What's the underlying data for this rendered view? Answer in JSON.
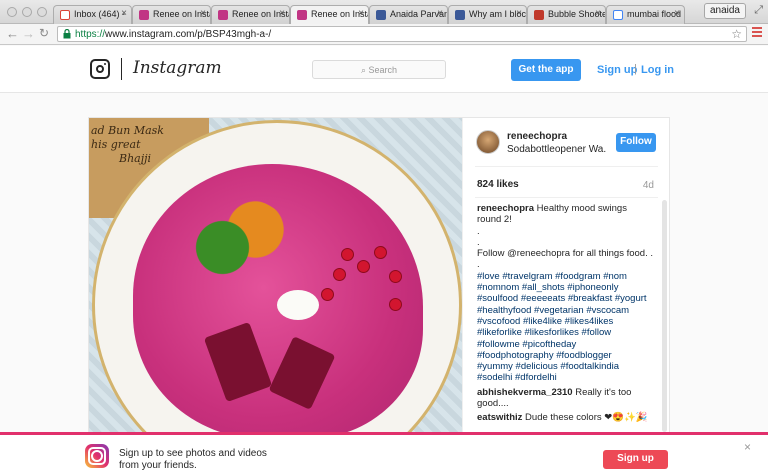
{
  "browser": {
    "tabs": [
      {
        "title": "Inbox (464) -",
        "favicon_color": "#db4437"
      },
      {
        "title": "Renee on Insta",
        "favicon_color": "#c13584"
      },
      {
        "title": "Renee on Insta",
        "favicon_color": "#c13584"
      },
      {
        "title": "Renee on Insta",
        "favicon_color": "#c13584"
      },
      {
        "title": "Anaida Parvan",
        "favicon_color": "#3b5998"
      },
      {
        "title": "Why am I bloc",
        "favicon_color": "#3b5998"
      },
      {
        "title": "Bubble Shoote",
        "favicon_color": "#c0392b"
      },
      {
        "title": "mumbai flood",
        "favicon_color": "#4285f4"
      }
    ],
    "profile": "anaida",
    "url_scheme": "https://",
    "url_rest": "www.instagram.com/p/BSP43mgh-a-/"
  },
  "header": {
    "wordmark": "Instagram",
    "search_placeholder": "Search",
    "get_app": "Get the app",
    "sign_up": "Sign up",
    "separator": "|",
    "log_in": "Log in"
  },
  "post": {
    "image_text": [
      "ad Bun Mask",
      "his great",
      "Bhajji"
    ],
    "username": "reneechopra",
    "location": "Sodabottleopener Wa...",
    "follow": "Follow",
    "likes": "824 likes",
    "age": "4d",
    "caption_user": "reneechopra",
    "caption_lines": [
      "Healthy mood swings",
      "round 2!",
      ".",
      ".",
      "Follow @reneechopra for all things food. .",
      ".",
      "#love #travelgram #foodgram #nom",
      "#nomnom #all_shots #iphoneonly",
      "#soulfood #eeeeeats #breakfast #yogurt",
      "#healthyfood #vegetarian #vscocam",
      "#vscofood #like4like #likes4likes",
      "#likeforlike #likesforlikes #follow",
      "#followme #picoftheday",
      "#foodphotography #foodblogger",
      "#yummy #delicious #foodtalkindia",
      "#sodelhi #dfordelhi"
    ],
    "comments": [
      {
        "user": "abhishekverma_2310",
        "text": "Really it's too good...."
      },
      {
        "user": "eatswithiz",
        "text": "Dude these colors ❤😍✨🎉"
      }
    ]
  },
  "banner": {
    "line1": "Sign up to see photos and videos",
    "line2": "from your friends.",
    "signup": "Sign up",
    "close": "×"
  },
  "colors": {
    "accent": "#3897f0",
    "banner_accent": "#e1306c",
    "signup_button": "#ed4956"
  }
}
